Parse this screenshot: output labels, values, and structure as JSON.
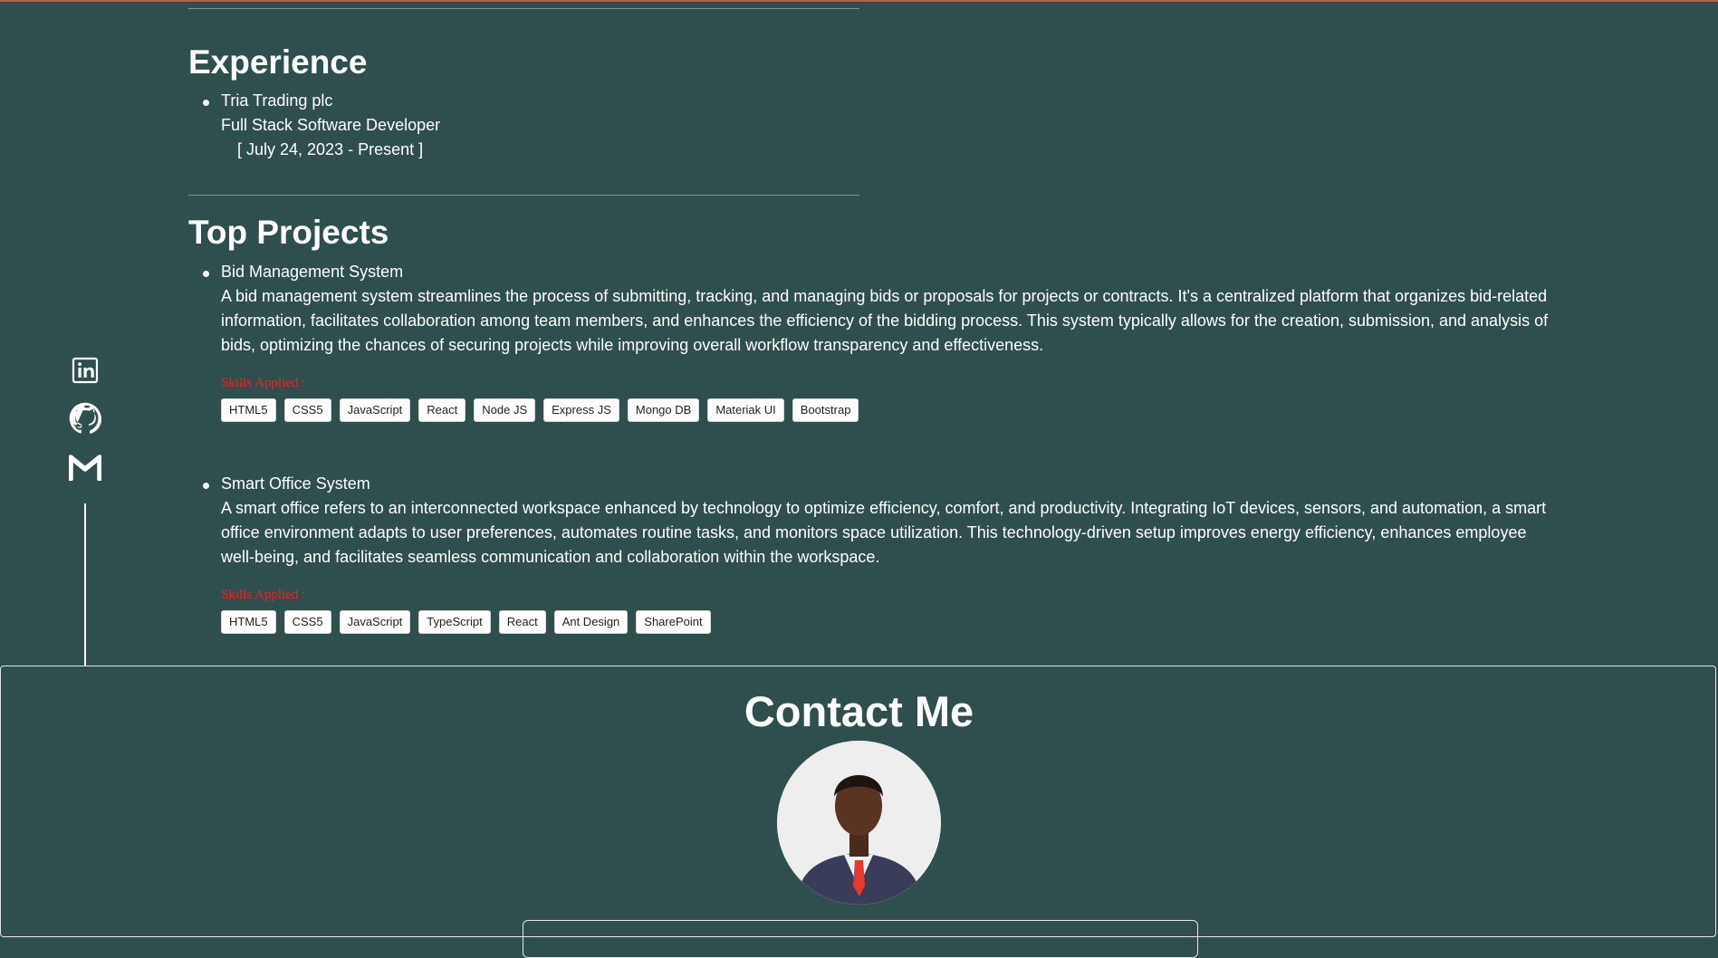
{
  "experience": {
    "title": "Experience",
    "items": [
      {
        "company": "Tria Trading plc",
        "role": "Full Stack Software Developer",
        "dates": "[ July 24, 2023 - Present ]"
      }
    ]
  },
  "projects": {
    "title": "Top Projects",
    "items": [
      {
        "name": "Bid Management System",
        "description": "A bid management system streamlines the process of submitting, tracking, and managing bids or proposals for projects or contracts. It's a centralized platform that organizes bid-related information, facilitates collaboration among team members, and enhances the efficiency of the bidding process. This system typically allows for the creation, submission, and analysis of bids, optimizing the chances of securing projects while improving overall workflow transparency and effectiveness.",
        "skills_label": "Skills Applied :",
        "skills": [
          "HTML5",
          "CSS5",
          "JavaScript",
          "React",
          "Node JS",
          "Express JS",
          "Mongo DB",
          "Materiak UI",
          "Bootstrap"
        ]
      },
      {
        "name": "Smart Office System",
        "description": "A smart office refers to an interconnected workspace enhanced by technology to optimize efficiency, comfort, and productivity. Integrating IoT devices, sensors, and automation, a smart office environment adapts to user preferences, automates routine tasks, and monitors space utilization. This technology-driven setup improves energy efficiency, enhances employee well-being, and facilitates seamless communication and collaboration within the workspace.",
        "skills_label": "Skills Applied :",
        "skills": [
          "HTML5",
          "CSS5",
          "JavaScript",
          "TypeScript",
          "React",
          "Ant Design",
          "SharePoint"
        ]
      }
    ]
  },
  "social": {
    "icons": [
      "linkedin-icon",
      "github-icon",
      "gmail-icon"
    ]
  },
  "contact": {
    "title": "Contact Me"
  },
  "colors": {
    "background": "#2f4f4f",
    "skills_label": "#ff1a1a",
    "top_accent": "#b5653f"
  }
}
